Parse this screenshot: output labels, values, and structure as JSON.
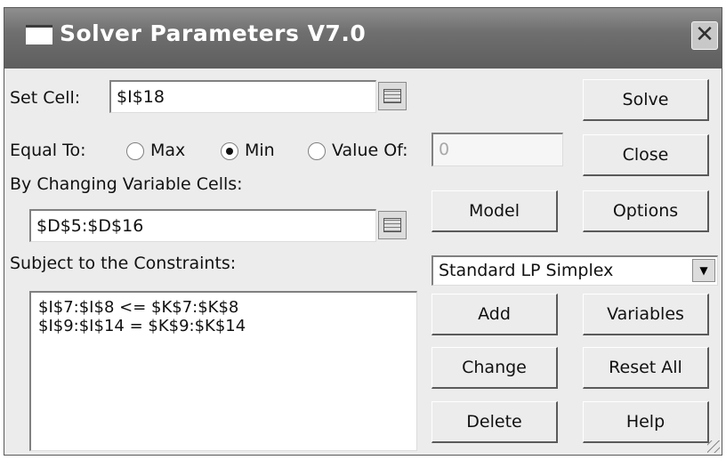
{
  "window": {
    "title": "Solver Parameters V7.0",
    "close_glyph": "✕"
  },
  "set_cell": {
    "label": "Set Cell:",
    "value": "$I$18"
  },
  "equal_to": {
    "label": "Equal To:",
    "options": [
      {
        "label": "Max",
        "checked": false
      },
      {
        "label": "Min",
        "checked": true
      },
      {
        "label": "Value Of:",
        "checked": false
      }
    ],
    "value_of": "0"
  },
  "changing_cells": {
    "label": "By Changing Variable Cells:",
    "value": "$D$5:$D$16"
  },
  "constraints": {
    "label": "Subject to the Constraints:",
    "items": [
      "$I$7:$I$8 <= $K$7:$K$8",
      "$I$9:$I$14 = $K$9:$K$14"
    ]
  },
  "engine": {
    "selected": "Standard LP Simplex"
  },
  "buttons": {
    "solve": "Solve",
    "close": "Close",
    "model": "Model",
    "options": "Options",
    "add": "Add",
    "variables": "Variables",
    "change": "Change",
    "reset_all": "Reset All",
    "delete": "Delete",
    "help": "Help"
  },
  "icons": {
    "window": "window-icon",
    "close": "close-icon",
    "ref": "range-select-icon",
    "dropdown": "chevron-down-icon"
  }
}
